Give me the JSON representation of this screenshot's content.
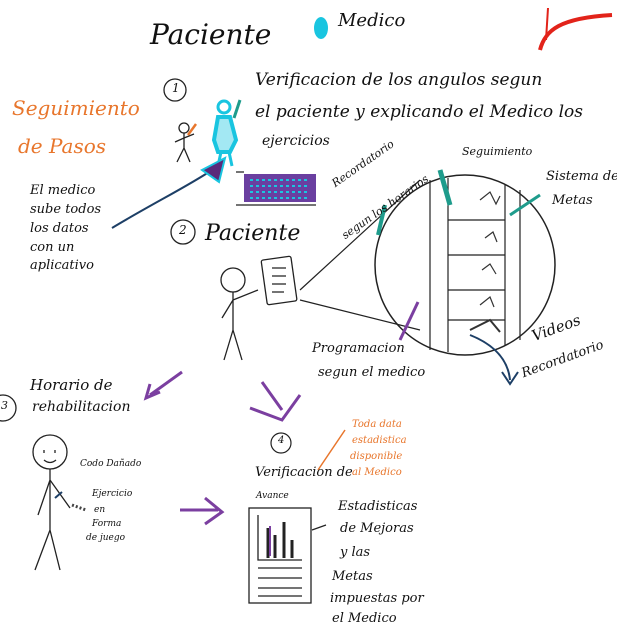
{
  "title": "Paciente",
  "legend_medico": "Medico",
  "step1": {
    "number": "1",
    "text": [
      "Verificacion de los angulos segun",
      "el paciente y explicando el Medico los",
      "ejercicios"
    ]
  },
  "seguimiento_pasos": [
    "Seguimiento",
    "de Pasos"
  ],
  "medico_note": [
    "El medico",
    "sube todos",
    "los datos",
    "con un",
    "aplicativo"
  ],
  "step2": {
    "number": "2",
    "text": "Paciente"
  },
  "phone_labels": {
    "recordatorio": [
      "Recordatorio",
      "segun los horarios"
    ],
    "seguimiento": "Seguimiento",
    "sistema_metas": [
      "Sistema de",
      "Metas"
    ],
    "programacion": [
      "Programacion",
      "segun el medico"
    ],
    "videos": [
      "Videos",
      "Recordatorio"
    ]
  },
  "step3": {
    "number": "3",
    "text": [
      "Horario de",
      "rehabilitacion"
    ]
  },
  "person3_labels": {
    "codo": "Codo Dañado",
    "ejercicio": [
      "Ejercicio",
      "en",
      "Forma",
      "de juego"
    ]
  },
  "step4": {
    "number": "4",
    "text": "Verificacion de",
    "sub": "Avance"
  },
  "orange_note": [
    "Toda data",
    "estadistica",
    "disponible",
    "al Medico"
  ],
  "stats_note": [
    "Estadisticas",
    "de Mejoras",
    "y las",
    "Metas",
    "impuestas por",
    "el Medico"
  ],
  "colors": {
    "cyan": "#19c5e0",
    "orange": "#e8762c",
    "red": "#e2231a",
    "navy": "#1d3f66",
    "purple": "#7b3fa0",
    "teal": "#1e9c8c"
  }
}
